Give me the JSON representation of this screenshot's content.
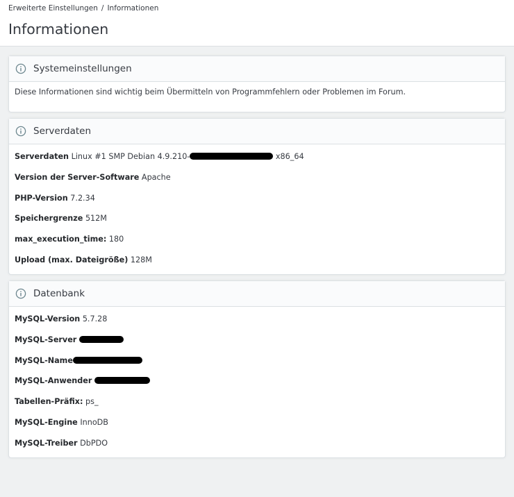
{
  "breadcrumb": {
    "parent": "Erweiterte Einstellungen",
    "separator": "/",
    "current": "Informationen"
  },
  "page_title": "Informationen",
  "system": {
    "title": "Systemeinstellungen",
    "text": "Diese Informationen sind wichtig beim Übermitteln von Programmfehlern oder Problemen im Forum."
  },
  "server": {
    "title": "Serverdaten",
    "rows": [
      {
        "label": "Serverdaten",
        "value_prefix": "Linux #1 SMP Debian 4.9.210-",
        "value_suffix": "x86_64"
      },
      {
        "label": "Version der Server-Software",
        "value": "Apache"
      },
      {
        "label": "PHP-Version",
        "value": "7.2.34"
      },
      {
        "label": "Speichergrenze",
        "value": "512M"
      },
      {
        "label": "max_execution_time:",
        "value": "180"
      },
      {
        "label": "Upload (max. Dateigröße)",
        "value": "128M"
      }
    ]
  },
  "database": {
    "title": "Datenbank",
    "rows": [
      {
        "label": "MySQL-Version",
        "value": "5.7.28"
      },
      {
        "label": "MySQL-Server",
        "value": ""
      },
      {
        "label": "MySQL-Name",
        "value": ""
      },
      {
        "label": "MySQL-Anwender",
        "value": ""
      },
      {
        "label": "Tabellen-Präfix:",
        "value": "ps_"
      },
      {
        "label": "MySQL-Engine",
        "value": "InnoDB"
      },
      {
        "label": "MySQL-Treiber",
        "value": "DbPDO"
      }
    ]
  },
  "icons": {
    "info": "info-circle-icon"
  },
  "colors": {
    "icon": "#6c868e",
    "redaction": "#000000"
  }
}
